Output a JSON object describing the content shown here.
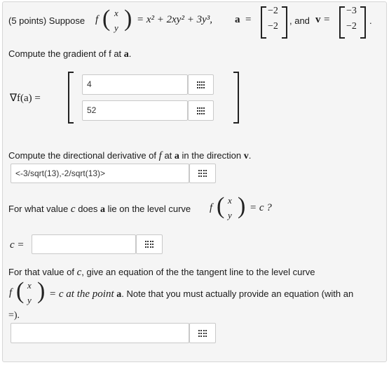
{
  "q1": {
    "points_label": "(5 points) Suppose",
    "f_letter": "f",
    "vec_top": "x",
    "vec_bot": "y",
    "eq_rhs": "= x² + 2xy² + 3y³,",
    "a_label": "a",
    "eq": "=",
    "a_top": "−2",
    "a_bot": "−2",
    "and_text": ", and",
    "v_label": "v",
    "eq2": "=",
    "v_top": "−3",
    "v_bot": "−2",
    "end_dot": "."
  },
  "gradient": {
    "prompt_pre": "Compute the gradient of f at",
    "prompt_a": "a",
    "prompt_end": ".",
    "lhs": "∇f(a) =",
    "val1": "4",
    "val2": "52"
  },
  "directional": {
    "prompt_pre": "Compute the directional derivative of",
    "f": "f",
    "at": "at",
    "a": "a",
    "in_dir": "in the direction",
    "v": "v",
    "end": ".",
    "value": "<-3/sqrt(13),-2/sqrt(13)>"
  },
  "level": {
    "prompt_pre": "For what value",
    "c": "c",
    "does": "does",
    "a": "a",
    "lie": "lie on the level curve",
    "f": "f",
    "vec_top": "x",
    "vec_bot": "y",
    "rhs": "= c ?",
    "c_label": "c =",
    "c_value": ""
  },
  "tangent": {
    "line1_pre": "For that value of",
    "c": "c",
    "line1_post": ", give an equation of the the tangent line to the level curve",
    "f": "f",
    "vec_top": "x",
    "vec_bot": "y",
    "line2_mid": "= c at the point",
    "a": "a",
    "line2_post": ". Note that you must actually provide an equation (with an",
    "line3": "=).",
    "value": ""
  }
}
